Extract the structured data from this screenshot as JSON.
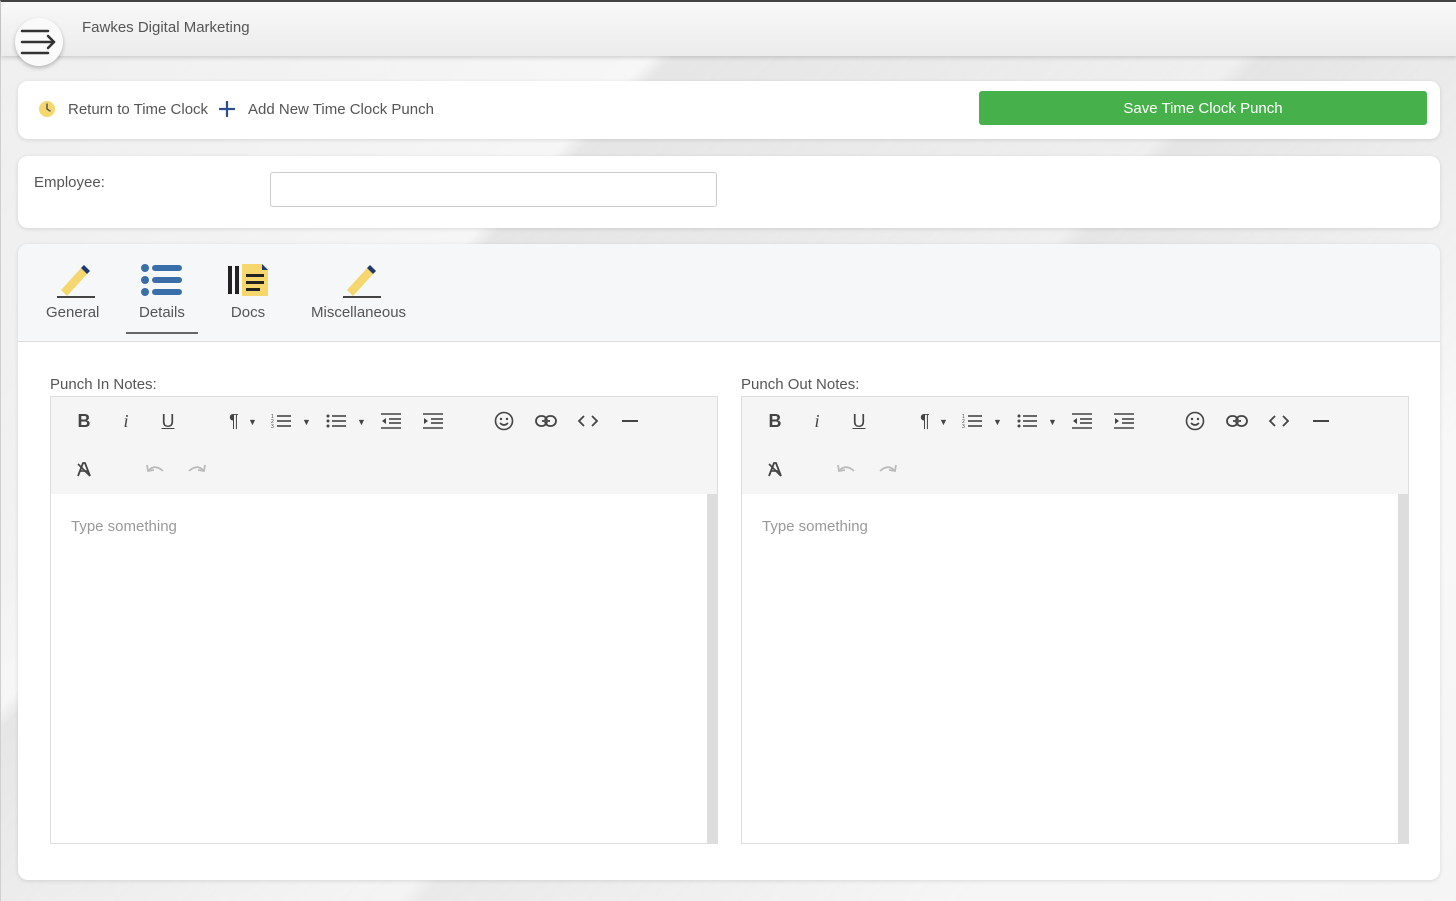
{
  "header": {
    "company": "Fawkes Digital Marketing",
    "menu_icon": "menu-arrow-icon"
  },
  "actions": {
    "return_label": "Return to Time Clock",
    "add_label": "Add New Time Clock Punch",
    "save_label": "Save Time Clock Punch",
    "save_color": "#46b04a"
  },
  "employee": {
    "label": "Employee:",
    "value": ""
  },
  "tabs": [
    {
      "label": "General",
      "icon": "pencil-icon"
    },
    {
      "label": "Details",
      "icon": "list-icon",
      "active": true
    },
    {
      "label": "Docs",
      "icon": "document-icon"
    },
    {
      "label": "Miscellaneous",
      "icon": "pencil-icon"
    }
  ],
  "editors": {
    "punch_in": {
      "label": "Punch In Notes:",
      "placeholder": "Type something"
    },
    "punch_out": {
      "label": "Punch Out Notes:",
      "placeholder": "Type something"
    }
  },
  "toolbar": {
    "bold": "B",
    "italic": "i",
    "underline": "U",
    "paragraph": "¶",
    "ordered_list": "ordered-list-icon",
    "unordered_list": "unordered-list-icon",
    "outdent": "outdent-icon",
    "indent": "indent-icon",
    "emoji": "emoji-icon",
    "link": "link-icon",
    "code": "code-icon",
    "hr": "horizontal-rule-icon",
    "clear_format": "clear-format-icon",
    "undo": "undo-icon",
    "redo": "redo-icon"
  }
}
